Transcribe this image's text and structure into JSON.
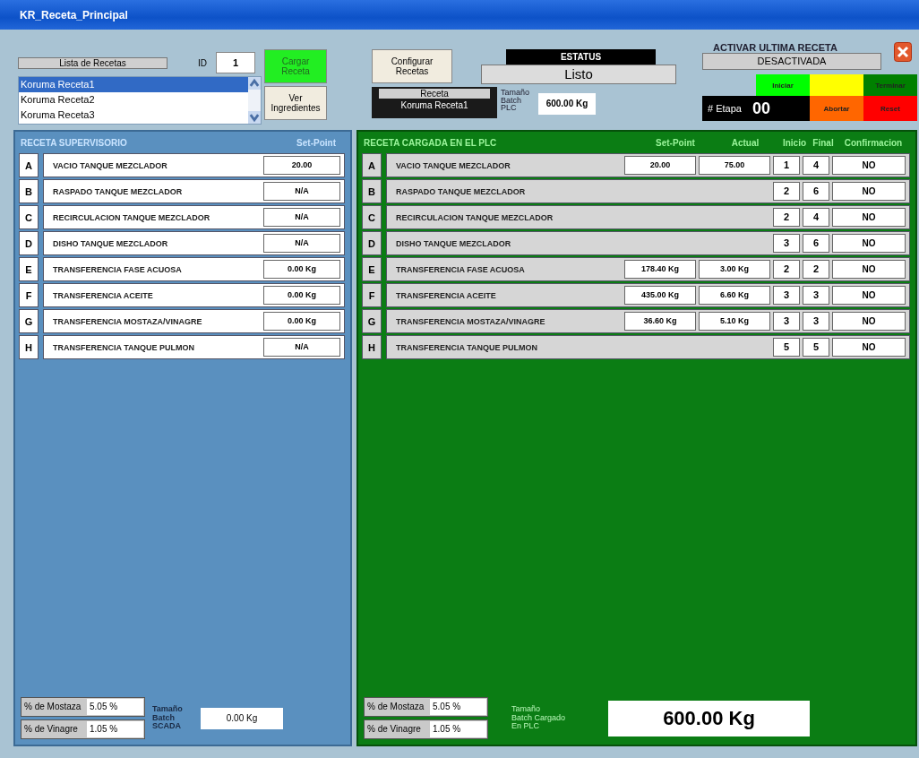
{
  "window": {
    "title": "KR_Receta_Principal"
  },
  "recipe_list": {
    "label": "Lista de Recetas",
    "id_label": "ID",
    "id_value": "1",
    "items": [
      {
        "name": "Koruma Receta1",
        "selected": true
      },
      {
        "name": "Koruma Receta2",
        "selected": false
      },
      {
        "name": "Koruma Receta3",
        "selected": false
      }
    ]
  },
  "actions": {
    "load": "Cargar Receta",
    "ingredients": "Ver Ingredientes",
    "configure": "Configurar Recetas"
  },
  "current_recipe": {
    "label": "Receta",
    "value": "Koruma Receta1"
  },
  "status": {
    "label": "ESTATUS",
    "value": "Listo"
  },
  "batch_plc": {
    "lines": [
      "Tamaño",
      "Batch",
      "PLC"
    ],
    "value": "600.00 Kg"
  },
  "last_recipe": {
    "label": "ACTIVAR ULTIMA RECETA",
    "value": "DESACTIVADA"
  },
  "controls": [
    {
      "label": "Iniciar",
      "color": "#00ff00"
    },
    {
      "color": "#ffff00"
    },
    {
      "label": "Terminar",
      "color": "#008000"
    },
    {
      "label": "Abortar",
      "color": "#ff6600"
    },
    {
      "label": "Reset",
      "color": "#ff0000"
    }
  ],
  "stage": {
    "label": "# Etapa",
    "value": "00"
  },
  "supervisory": {
    "title": "RECETA SUPERVISORIO",
    "setpoint_header": "Set-Point",
    "rows": [
      {
        "letter": "A",
        "name": "VACIO TANQUE MEZCLADOR",
        "setpoint": "20.00"
      },
      {
        "letter": "B",
        "name": "RASPADO TANQUE MEZCLADOR",
        "setpoint": "N/A"
      },
      {
        "letter": "C",
        "name": "RECIRCULACION TANQUE MEZCLADOR",
        "setpoint": "N/A"
      },
      {
        "letter": "D",
        "name": "DISHO TANQUE MEZCLADOR",
        "setpoint": "N/A"
      },
      {
        "letter": "E",
        "name": "TRANSFERENCIA FASE ACUOSA",
        "setpoint": "0.00 Kg"
      },
      {
        "letter": "F",
        "name": "TRANSFERENCIA ACEITE",
        "setpoint": "0.00 Kg"
      },
      {
        "letter": "G",
        "name": "TRANSFERENCIA MOSTAZA/VINAGRE",
        "setpoint": "0.00 Kg"
      },
      {
        "letter": "H",
        "name": "TRANSFERENCIA TANQUE PULMON",
        "setpoint": "N/A"
      }
    ],
    "percentages": [
      {
        "label": "% de Mostaza",
        "value": "5.05 %"
      },
      {
        "label": "% de Vinagre",
        "value": "1.05 %"
      }
    ],
    "batch": {
      "lines": [
        "Tamaño",
        "Batch",
        "SCADA"
      ],
      "value": "0.00 Kg"
    }
  },
  "plc": {
    "title": "RECETA CARGADA EN EL PLC",
    "columns": [
      "Set-Point",
      "Actual",
      "Inicio",
      "Final",
      "Confirmacion"
    ],
    "rows": [
      {
        "letter": "A",
        "name": "VACIO TANQUE MEZCLADOR",
        "setpoint": "20.00",
        "actual": "75.00",
        "start": "1",
        "end": "4",
        "confirmation": "NO"
      },
      {
        "letter": "B",
        "name": "RASPADO TANQUE MEZCLADOR",
        "start": "2",
        "end": "6",
        "confirmation": "NO"
      },
      {
        "letter": "C",
        "name": "RECIRCULACION TANQUE MEZCLADOR",
        "start": "2",
        "end": "4",
        "confirmation": "NO"
      },
      {
        "letter": "D",
        "name": "DISHO TANQUE MEZCLADOR",
        "start": "3",
        "end": "6",
        "confirmation": "NO"
      },
      {
        "letter": "E",
        "name": "TRANSFERENCIA FASE ACUOSA",
        "setpoint": "178.40 Kg",
        "actual": "3.00 Kg",
        "start": "2",
        "end": "2",
        "confirmation": "NO"
      },
      {
        "letter": "F",
        "name": "TRANSFERENCIA ACEITE",
        "setpoint": "435.00 Kg",
        "actual": "6.60 Kg",
        "start": "3",
        "end": "3",
        "confirmation": "NO"
      },
      {
        "letter": "G",
        "name": "TRANSFERENCIA MOSTAZA/VINAGRE",
        "setpoint": "36.60 Kg",
        "actual": "5.10 Kg",
        "start": "3",
        "end": "3",
        "confirmation": "NO"
      },
      {
        "letter": "H",
        "name": "TRANSFERENCIA TANQUE PULMON",
        "start": "5",
        "end": "5",
        "confirmation": "NO"
      }
    ],
    "percentages": [
      {
        "label": "% de Mostaza",
        "value": "5.05 %"
      },
      {
        "label": "% de Vinagre",
        "value": "1.05 %"
      }
    ],
    "batch": {
      "lines": [
        "Tamaño",
        "Batch Cargado",
        "En PLC"
      ],
      "value": "600.00 Kg"
    }
  }
}
